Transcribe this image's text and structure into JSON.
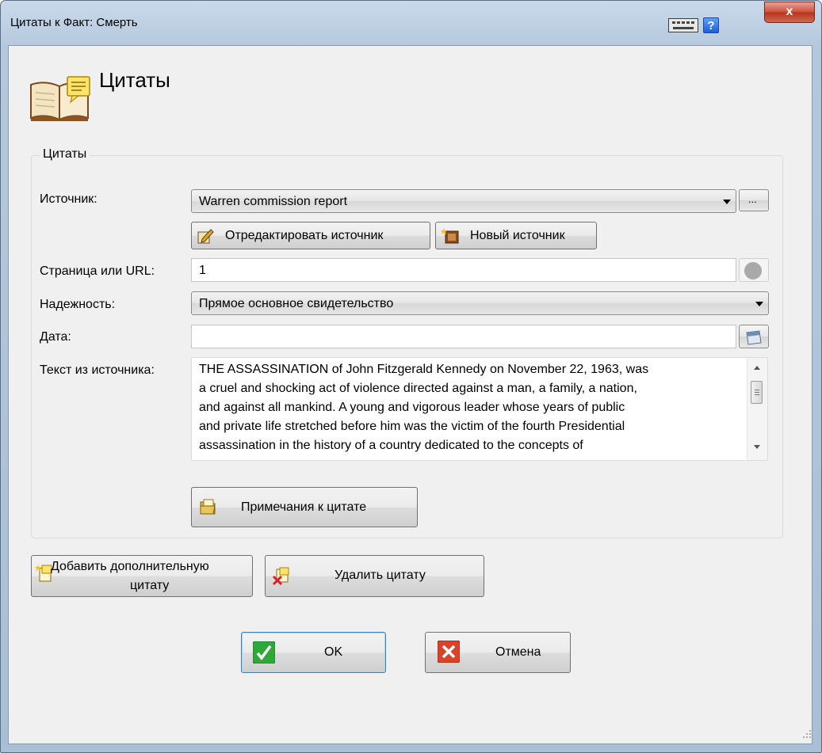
{
  "window": {
    "title": "Цитаты к Факт: Смерть",
    "close_label": "x",
    "help_label": "?",
    "icons": {
      "keyboard": "keyboard-icon",
      "help": "help-icon",
      "close": "close-icon"
    }
  },
  "header": {
    "title": "Цитаты",
    "icon": "book-note-icon"
  },
  "group": {
    "legend": "Цитаты"
  },
  "form": {
    "source": {
      "label": "Источник:",
      "value": "Warren commission report",
      "browse_label": "...",
      "edit_source_label": "Отредактировать источник",
      "new_source_label": "Новый источник"
    },
    "page": {
      "label": "Страница или URL:",
      "value": "1"
    },
    "reliability": {
      "label": "Надежность:",
      "value": "Прямое основное свидетельство"
    },
    "date": {
      "label": "Дата:",
      "value": ""
    },
    "text": {
      "label": "Текст из источника:",
      "lines": [
        "THE ASSASSINATION of John Fitzgerald Kennedy on November 22, 1963, was",
        "a cruel and shocking act of violence directed against a man, a family, a nation,",
        "and against all mankind. A young and vigorous leader whose years of public",
        "and private life stretched before him was the victim of the fourth Presidential",
        "assassination in the history of a country dedicated to the concepts of"
      ]
    },
    "notes_label": "Примечания к цитате"
  },
  "actions": {
    "add_line1": "Добавить дополнительную",
    "add_line2": "цитату",
    "delete_label": "Удалить цитату",
    "ok_label": "OK",
    "cancel_label": "Отмена"
  },
  "colors": {
    "ok_green": "#2fa83a",
    "cancel_red": "#d8432c",
    "focus_blue": "#3c7fb1"
  }
}
